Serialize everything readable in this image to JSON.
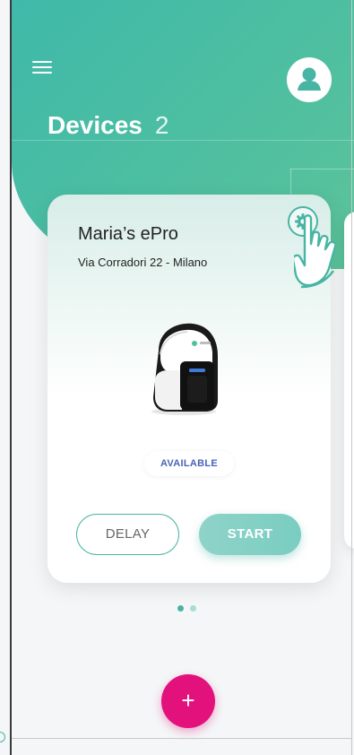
{
  "header": {
    "title": "Devices",
    "device_count": "2",
    "menu_icon": "hamburger-menu-icon",
    "profile_icon": "user-avatar-icon"
  },
  "device_card": {
    "name": "Maria’s ePro",
    "address": "Via Corradori 22 - Milano",
    "settings_icon": "gear-icon",
    "status": "AVAILABLE",
    "delay_label": "DELAY",
    "start_label": "START"
  },
  "pagination": {
    "current": 1,
    "total": 2
  },
  "fab": {
    "label": "+"
  },
  "colors": {
    "brand_green": "#48b5a4",
    "header_gradient_start": "#3fb9aa",
    "header_gradient_end": "#5cc39a",
    "fab_pink": "#e3117c",
    "status_blue": "#4a63b8"
  }
}
